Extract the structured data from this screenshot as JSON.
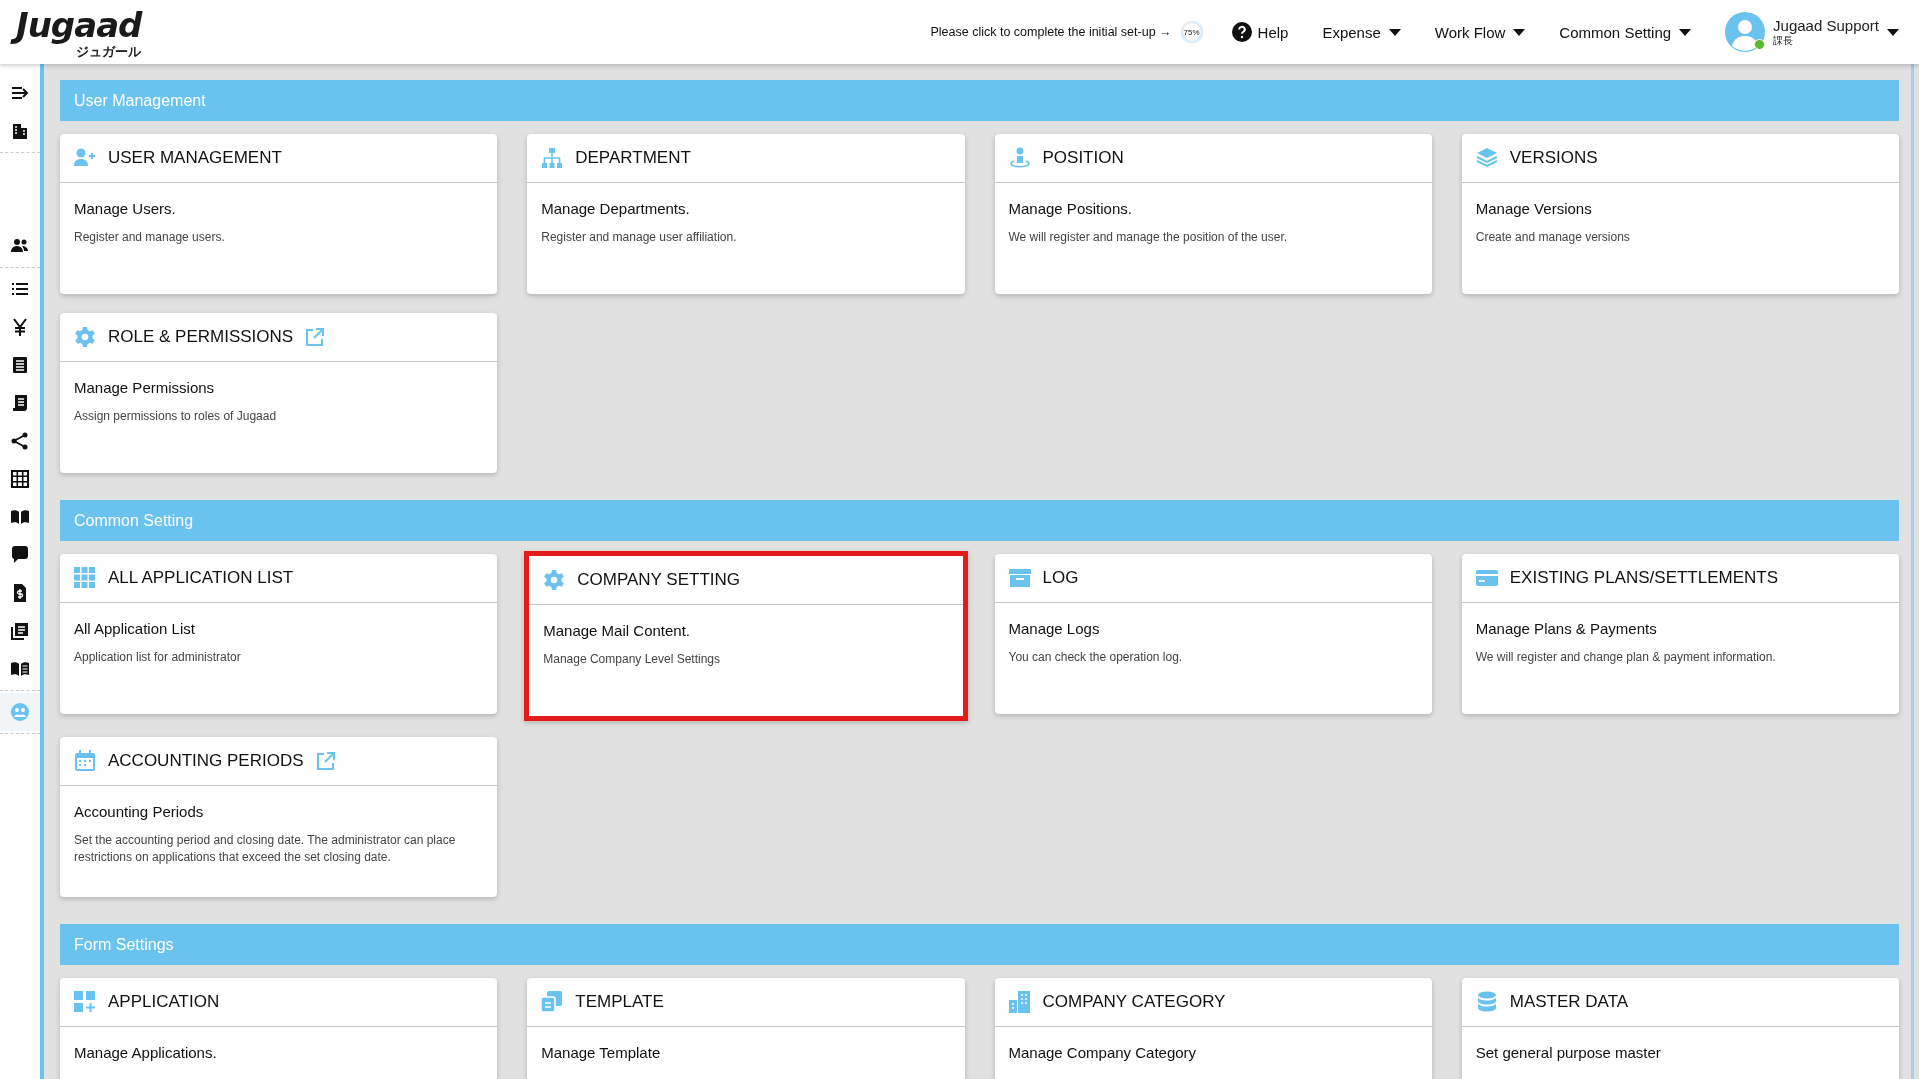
{
  "header": {
    "logo": "Jugaad",
    "logo_sub": "ジュガール",
    "setup_prompt": "Please click to complete the initial set-up →",
    "setup_progress": {
      "label": "75%",
      "level": 0.75
    },
    "help": "Help",
    "menus": [
      "Expense",
      "Work Flow",
      "Common Setting"
    ],
    "user": {
      "name": "Jugaad Support",
      "role": "課長",
      "online": true
    }
  },
  "sidebar": {
    "items": [
      {
        "selected": false
      },
      {
        "selected": false
      },
      {
        "selected": false
      },
      {
        "selected": false
      },
      {
        "selected": false
      },
      {
        "selected": false
      },
      {
        "selected": false
      },
      {
        "selected": false
      },
      {
        "selected": false
      },
      {
        "selected": false
      },
      {
        "selected": false
      },
      {
        "selected": false
      },
      {
        "selected": false
      },
      {
        "selected": false
      },
      {
        "selected": true
      }
    ]
  },
  "sections": [
    {
      "title": "User Management",
      "cards": [
        {
          "title": "USER MANAGEMENT",
          "external_link": false,
          "highlighted": false,
          "headline": "Manage Users.",
          "description": "Register and manage users."
        },
        {
          "title": "DEPARTMENT",
          "external_link": false,
          "highlighted": false,
          "headline": "Manage Departments.",
          "description": "Register and manage user affiliation."
        },
        {
          "title": "POSITION",
          "external_link": false,
          "highlighted": false,
          "headline": "Manage Positions.",
          "description": "We will register and manage the position of the user."
        },
        {
          "title": "VERSIONS",
          "external_link": false,
          "highlighted": false,
          "headline": "Manage Versions",
          "description": "Create and manage versions"
        },
        {
          "title": "ROLE & PERMISSIONS",
          "external_link": true,
          "highlighted": false,
          "headline": "Manage Permissions",
          "description": "Assign permissions to roles of Jugaad"
        }
      ]
    },
    {
      "title": "Common Setting",
      "cards": [
        {
          "title": "ALL APPLICATION LIST",
          "external_link": false,
          "highlighted": false,
          "headline": "All Application List",
          "description": "Application list for administrator"
        },
        {
          "title": "COMPANY SETTING",
          "external_link": false,
          "highlighted": true,
          "headline": "Manage Mail Content.",
          "description": "Manage Company Level Settings"
        },
        {
          "title": "LOG",
          "external_link": false,
          "highlighted": false,
          "headline": "Manage Logs",
          "description": "You can check the operation log."
        },
        {
          "title": "EXISTING PLANS/SETTLEMENTS",
          "external_link": false,
          "highlighted": false,
          "headline": "Manage Plans & Payments",
          "description": "We will register and change plan & payment information."
        },
        {
          "title": "ACCOUNTING PERIODS",
          "external_link": true,
          "highlighted": false,
          "headline": "Accounting Periods",
          "description": "Set the accounting period and closing date. The administrator can place restrictions on applications that exceed the set closing date."
        }
      ]
    },
    {
      "title": "Form Settings",
      "cards": [
        {
          "title": "APPLICATION",
          "external_link": false,
          "highlighted": false,
          "headline": "Manage Applications."
        },
        {
          "title": "TEMPLATE",
          "external_link": false,
          "highlighted": false,
          "headline": "Manage Template"
        },
        {
          "title": "COMPANY CATEGORY",
          "external_link": false,
          "highlighted": false,
          "headline": "Manage Company Category"
        },
        {
          "title": "MASTER DATA",
          "external_link": false,
          "highlighted": false,
          "headline": "Set general purpose master"
        }
      ]
    }
  ]
}
